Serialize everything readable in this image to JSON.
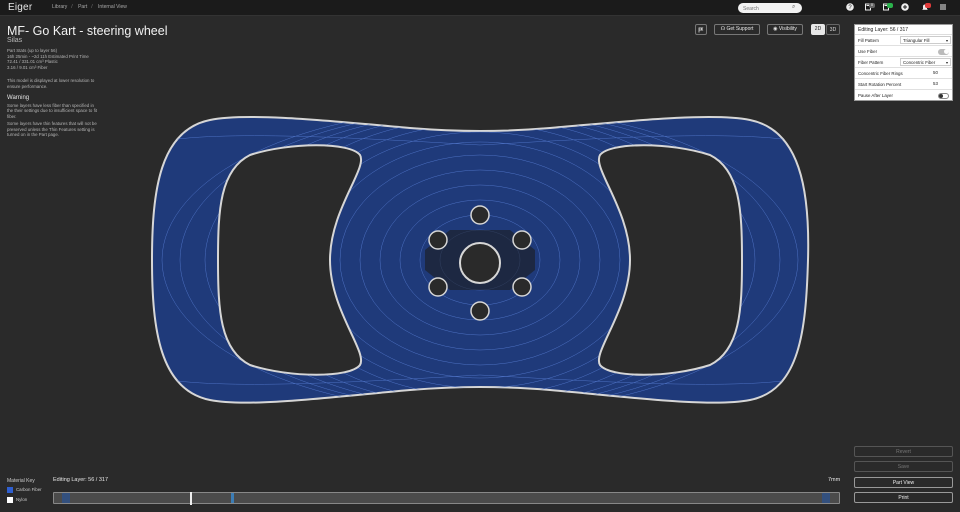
{
  "app": {
    "logo": "Eiger"
  },
  "breadcrumbs": [
    "Library",
    "Part",
    "Internal View"
  ],
  "search": {
    "placeholder": "Search"
  },
  "part": {
    "title": "MF- Go Kart - steering wheel",
    "subtitle": "Silas",
    "stats_header": "Part Stats (up to layer 56)",
    "print_time": "16h 25min - ~2d 11h Estimated Print Time",
    "plastic": "72.41 / 331.01 cm³ Plastic",
    "fiber": "3.16 / 9.01 cm³ Fiber",
    "lowres_note": "This model is displayed at lower resolution to ensure performance."
  },
  "warning": {
    "heading": "Warning",
    "text1": "Some layers have less fiber than specified in the their settings due to insufficient space to fit fiber.",
    "text2": "Some layers have thin features that will not be preserved unless the Thin Features setting is turned on in the Part page."
  },
  "toolbar": {
    "support_label": "Get Support",
    "visibility_label": "Visibility",
    "view_2d": "2D",
    "view_3d": "3D",
    "active_view": "2D"
  },
  "panel": {
    "header": "Editing Layer: 56 / 317",
    "fill_pattern_label": "Fill Pattern",
    "fill_pattern_value": "Triangular Fill",
    "use_fiber_label": "Use Fiber",
    "use_fiber_on": true,
    "fiber_pattern_label": "Fiber Pattern",
    "fiber_pattern_value": "Concentric Fiber",
    "rings_label": "Concentric Fiber Rings",
    "rings_value": "50",
    "rotation_label": "Start Rotation Percent",
    "rotation_value": "53",
    "pause_label": "Pause After Layer",
    "pause_on": false
  },
  "actions": {
    "revert": "Revert",
    "save": "Save",
    "part_view": "Part View",
    "print": "Print"
  },
  "material_key": {
    "heading": "Material Key",
    "items": [
      {
        "label": "Carbon Fiber",
        "color": "#2f5fd0"
      },
      {
        "label": "Nylon",
        "color": "#ffffff"
      }
    ]
  },
  "layer_slider": {
    "label": "Editing Layer: 56 / 317",
    "height_label": "7mm",
    "current": 56,
    "total": 317
  },
  "colors": {
    "fiber_fill": "#1f3a7a",
    "fiber_line": "#4f78d8",
    "wall": "#d0d0d0",
    "background": "#2a2a2a"
  }
}
